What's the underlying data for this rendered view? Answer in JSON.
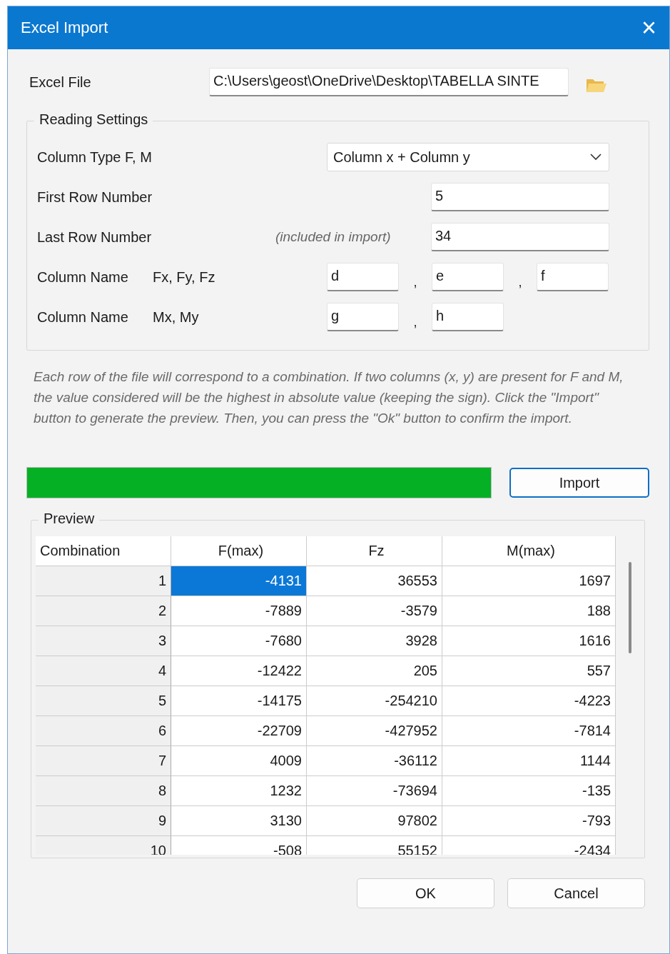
{
  "window": {
    "title": "Excel Import",
    "close": "×"
  },
  "excel_file": {
    "label": "Excel File",
    "value": "C:\\Users\\geost\\OneDrive\\Desktop\\TABELLA SINTE"
  },
  "reading_settings": {
    "title": "Reading Settings",
    "column_type": {
      "label": "Column Type F, M",
      "value": "Column x + Column y"
    },
    "first_row": {
      "label": "First Row Number",
      "value": "5"
    },
    "last_row": {
      "label": "Last Row Number",
      "hint": "(included in import)",
      "value": "34"
    },
    "force_columns": {
      "label": "Column Name",
      "sub": "Fx, Fy, Fz",
      "separator": ",",
      "values": [
        "d",
        "e",
        "f"
      ]
    },
    "moment_columns": {
      "label": "Column Name",
      "sub": "Mx, My",
      "separator": ",",
      "values": [
        "g",
        "h"
      ]
    }
  },
  "description": "Each row of the file will correspond to a combination. If two columns (x, y) are present for F and M, the value considered will be the highest in absolute value (keeping the sign). Click the \"Import\" button to generate the preview. Then, you can press the \"Ok\" button to confirm the import.",
  "progress": {
    "level": 1
  },
  "import_button": "Import",
  "preview": {
    "title": "Preview",
    "columns": [
      "Combination",
      "F(max)",
      "Fz",
      "M(max)"
    ],
    "rows": [
      {
        "number": "1",
        "cells": [
          {
            "text": "-4131",
            "selected": true
          },
          {
            "text": "36553",
            "selected": false
          },
          {
            "text": "1697",
            "selected": false
          }
        ]
      },
      {
        "number": "2",
        "cells": [
          {
            "text": "-7889",
            "selected": false
          },
          {
            "text": "-3579",
            "selected": false
          },
          {
            "text": "188",
            "selected": false
          }
        ]
      },
      {
        "number": "3",
        "cells": [
          {
            "text": "-7680",
            "selected": false
          },
          {
            "text": "3928",
            "selected": false
          },
          {
            "text": "1616",
            "selected": false
          }
        ]
      },
      {
        "number": "4",
        "cells": [
          {
            "text": "-12422",
            "selected": false
          },
          {
            "text": "205",
            "selected": false
          },
          {
            "text": "557",
            "selected": false
          }
        ]
      },
      {
        "number": "5",
        "cells": [
          {
            "text": "-14175",
            "selected": false
          },
          {
            "text": "-254210",
            "selected": false
          },
          {
            "text": "-4223",
            "selected": false
          }
        ]
      },
      {
        "number": "6",
        "cells": [
          {
            "text": "-22709",
            "selected": false
          },
          {
            "text": "-427952",
            "selected": false
          },
          {
            "text": "-7814",
            "selected": false
          }
        ]
      },
      {
        "number": "7",
        "cells": [
          {
            "text": "4009",
            "selected": false
          },
          {
            "text": "-36112",
            "selected": false
          },
          {
            "text": "1144",
            "selected": false
          }
        ]
      },
      {
        "number": "8",
        "cells": [
          {
            "text": "1232",
            "selected": false
          },
          {
            "text": "-73694",
            "selected": false
          },
          {
            "text": "-135",
            "selected": false
          }
        ]
      },
      {
        "number": "9",
        "cells": [
          {
            "text": "3130",
            "selected": false
          },
          {
            "text": "97802",
            "selected": false
          },
          {
            "text": "-793",
            "selected": false
          }
        ]
      },
      {
        "number": "10",
        "cells": [
          {
            "text": "-508",
            "selected": false
          },
          {
            "text": "55152",
            "selected": false
          },
          {
            "text": "-2434",
            "selected": false
          }
        ]
      }
    ]
  },
  "buttons": [
    "OK",
    "Cancel"
  ]
}
